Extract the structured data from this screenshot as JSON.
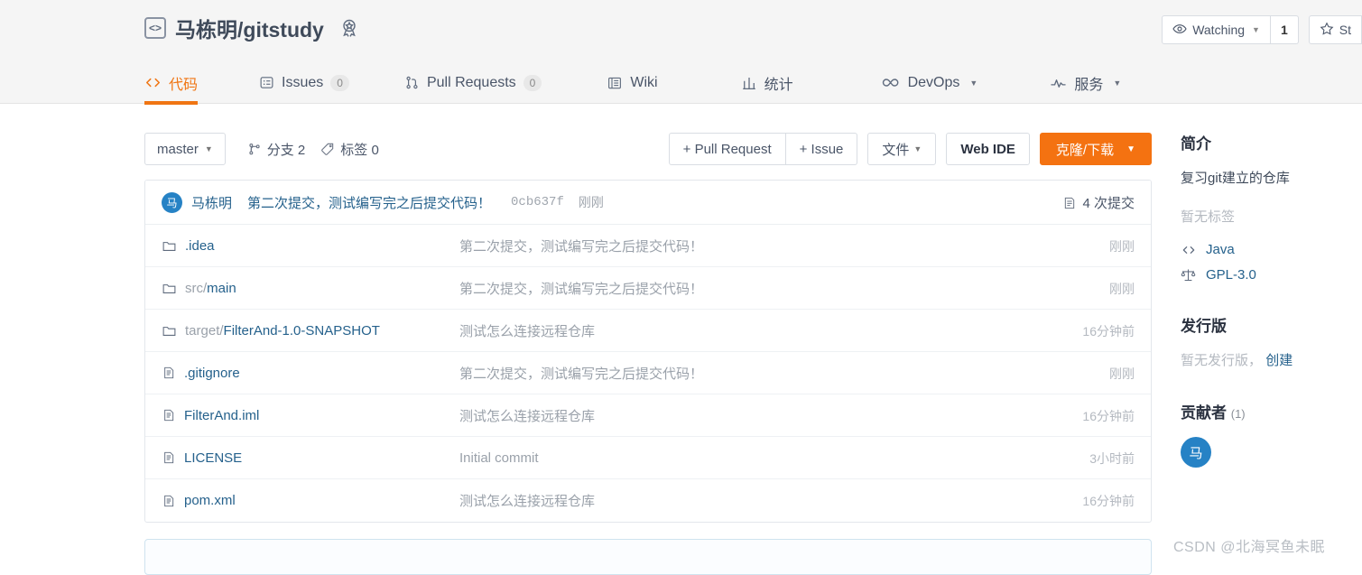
{
  "header": {
    "code_icon": "code-brackets-icon",
    "owner": "马栋明",
    "separator": "/",
    "repo": "gitstudy",
    "badge_icon": "award-badge-icon",
    "watch_label": "Watching",
    "watch_count": "1",
    "star_label": "St",
    "eye_icon": "eye-icon",
    "star_icon": "star-icon"
  },
  "nav": {
    "tabs": [
      {
        "label": "代码",
        "icon": "code-icon",
        "count": null,
        "active": true,
        "caret": false
      },
      {
        "label": "Issues",
        "icon": "issue-icon",
        "count": "0",
        "active": false,
        "caret": false
      },
      {
        "label": "Pull Requests",
        "icon": "pull-request-icon",
        "count": "0",
        "active": false,
        "caret": false
      },
      {
        "label": "Wiki",
        "icon": "book-icon",
        "count": null,
        "active": false,
        "caret": false
      },
      {
        "label": "统计",
        "icon": "chart-icon",
        "count": null,
        "active": false,
        "caret": false
      },
      {
        "label": "DevOps",
        "icon": "infinity-icon",
        "count": null,
        "active": false,
        "caret": true
      },
      {
        "label": "服务",
        "icon": "pulse-icon",
        "count": null,
        "active": false,
        "caret": true
      }
    ]
  },
  "toolbar": {
    "branch": "master",
    "branch_icon": "branch-icon",
    "branches_label": "分支 2",
    "tags_label": "标签 0",
    "tag_icon": "tag-icon",
    "pull_request_btn": "+ Pull Request",
    "issue_btn": "+ Issue",
    "files_btn": "文件",
    "web_ide_btn": "Web IDE",
    "clone_btn": "克隆/下载"
  },
  "commit": {
    "avatar_initial": "马",
    "author": "马栋明",
    "message": "第二次提交，测试编写完之后提交代码！",
    "sha": "0cb637f",
    "time": "刚刚",
    "commits_count_label": "4 次提交",
    "commits_icon": "commit-list-icon"
  },
  "files": [
    {
      "icon": "folder-icon",
      "prefix": "",
      "name": ".idea",
      "message": "第二次提交，测试编写完之后提交代码！",
      "time": "刚刚"
    },
    {
      "icon": "folder-icon",
      "prefix": "src/",
      "name": "main",
      "message": "第二次提交，测试编写完之后提交代码！",
      "time": "刚刚"
    },
    {
      "icon": "folder-icon",
      "prefix": "target/",
      "name": "FilterAnd-1.0-SNAPSHOT",
      "message": "测试怎么连接远程仓库",
      "time": "16分钟前"
    },
    {
      "icon": "file-icon",
      "prefix": "",
      "name": ".gitignore",
      "message": "第二次提交，测试编写完之后提交代码！",
      "time": "刚刚"
    },
    {
      "icon": "file-icon",
      "prefix": "",
      "name": "FilterAnd.iml",
      "message": "测试怎么连接远程仓库",
      "time": "16分钟前"
    },
    {
      "icon": "file-icon",
      "prefix": "",
      "name": "LICENSE",
      "message": "Initial commit",
      "time": "3小时前"
    },
    {
      "icon": "file-icon",
      "prefix": "",
      "name": "pom.xml",
      "message": "测试怎么连接远程仓库",
      "time": "16分钟前"
    }
  ],
  "sidebar": {
    "about_title": "简介",
    "description": "复习git建立的仓库",
    "no_tags": "暂无标签",
    "language": "Java",
    "language_icon": "code-icon",
    "license": "GPL-3.0",
    "license_icon": "scale-icon",
    "releases_title": "发行版",
    "releases_empty": "暂无发行版，",
    "releases_create": "创建",
    "contributors_title": "贡献者",
    "contributors_count": "(1)",
    "contributor_initial": "马"
  },
  "watermark": "CSDN @北海冥鱼未眠",
  "colors": {
    "accent": "#f07513",
    "clone_button": "#f47211",
    "link": "#25618c",
    "avatar": "#2682c5",
    "band": "#f5f5f5"
  }
}
